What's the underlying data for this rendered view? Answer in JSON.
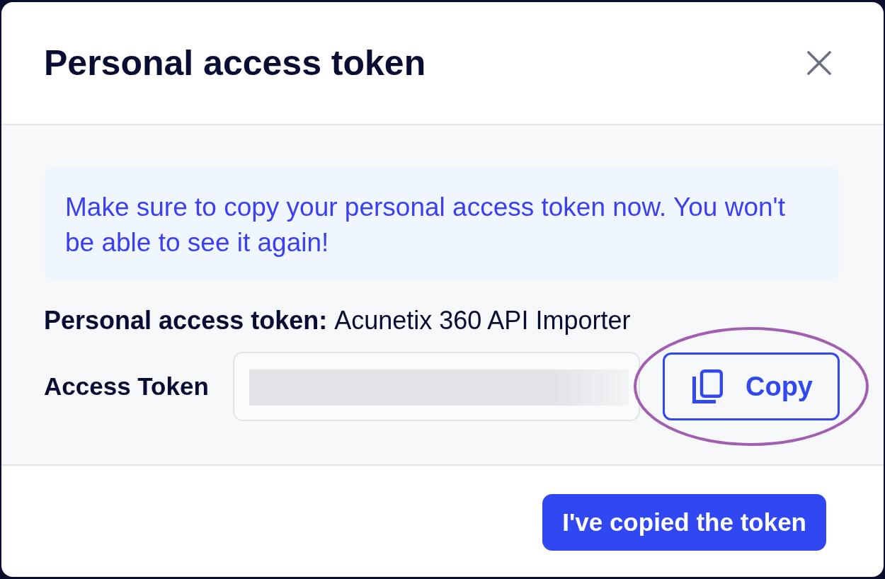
{
  "dialog": {
    "title": "Personal access token"
  },
  "notice": {
    "text": "Make sure to copy your personal access token now. You won't be able to see it again!"
  },
  "token_name": {
    "label": "Personal access token:",
    "value": "Acunetix 360 API Importer"
  },
  "access_token": {
    "label": "Access Token",
    "redacted": true,
    "copy_button": {
      "label": "Copy",
      "highlighted": true
    }
  },
  "footer": {
    "confirm_button": {
      "label": "I've copied the token"
    }
  }
}
